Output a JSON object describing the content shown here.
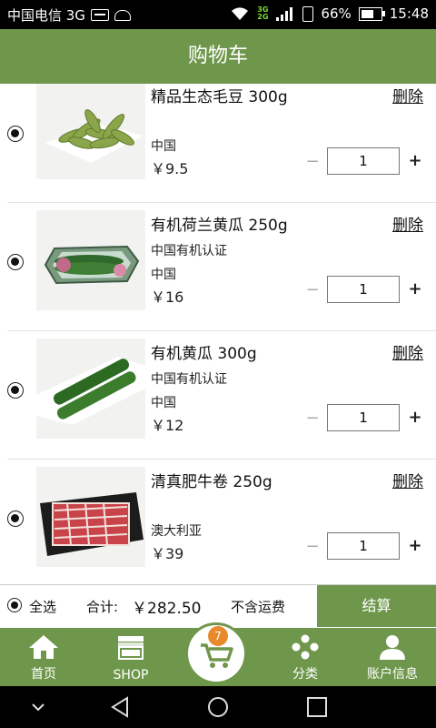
{
  "status": {
    "carrier": "中国电信 3G",
    "net_top": "3G",
    "net_bottom": "2G",
    "battery": "66%",
    "battery_level": 0.66,
    "time": "15:48"
  },
  "header": {
    "title": "购物车"
  },
  "items": [
    {
      "title": "精品生态毛豆 300g",
      "subtitle": "",
      "origin": "中国",
      "price": "￥9.5",
      "quantity": "1",
      "delete": "删除",
      "minus": "−",
      "plus": "+"
    },
    {
      "title": "有机荷兰黄瓜 250g",
      "subtitle": "中国有机认证",
      "origin": "中国",
      "price": "￥16",
      "quantity": "1",
      "delete": "删除",
      "minus": "−",
      "plus": "+"
    },
    {
      "title": "有机黄瓜  300g",
      "subtitle": "中国有机认证",
      "origin": "中国",
      "price": "￥12",
      "quantity": "1",
      "delete": "删除",
      "minus": "−",
      "plus": "+"
    },
    {
      "title": "清真肥牛卷 250g",
      "subtitle": "",
      "origin": "澳大利亚",
      "price": "￥39",
      "quantity": "1",
      "delete": "删除",
      "minus": "−",
      "plus": "+"
    }
  ],
  "summary": {
    "select_all": "全选",
    "total_label": "合计:",
    "total_value": "￥282.50",
    "shipping_note": "不含运费",
    "checkout": "结算"
  },
  "tabs": {
    "home": "首页",
    "shop": "SHOP",
    "cart_badge": "7",
    "category": "分类",
    "account": "账户信息"
  },
  "colors": {
    "brand_green": "#6f974c",
    "badge_orange": "#e78a2c"
  }
}
